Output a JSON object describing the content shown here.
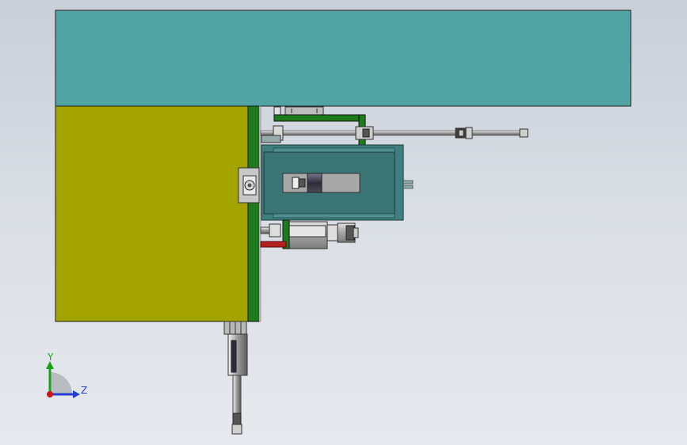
{
  "viewport": {
    "background_top": "#c9ced8",
    "background_bottom": "#e6e9ee"
  },
  "model": {
    "parts": [
      {
        "name": "top-plate",
        "color": "#52a3a3"
      },
      {
        "name": "side-block",
        "color": "#a3a300"
      },
      {
        "name": "green-mounting-plate",
        "color": "#1d7a1d"
      },
      {
        "name": "motor-housing",
        "color": "#3f7f7f"
      },
      {
        "name": "cylinder-body",
        "color": "#a8a8a8"
      },
      {
        "name": "red-rod",
        "color": "#b42020"
      }
    ]
  },
  "triad": {
    "y_label": "Y",
    "z_label": "Z",
    "y_color": "#1aa31a",
    "z_color": "#2540d0",
    "x_color": "#d01515"
  }
}
